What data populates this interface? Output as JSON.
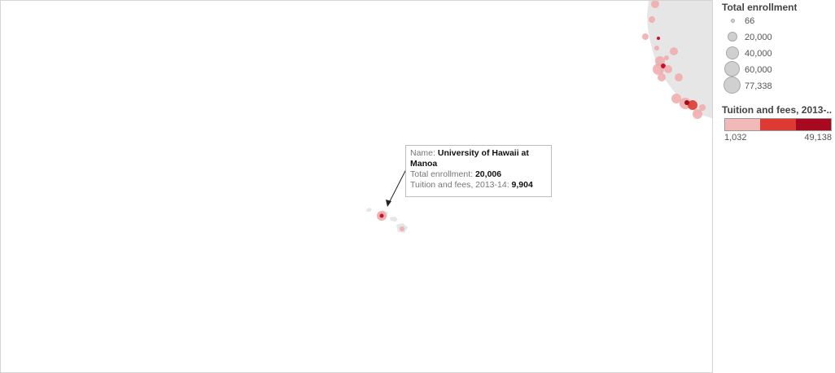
{
  "legend": {
    "size_title": "Total  enrollment",
    "size_items": [
      "66",
      "20,000",
      "40,000",
      "60,000",
      "77,338"
    ],
    "color_title": "Tuition and fees, 2013-..",
    "color_min": "1,032",
    "color_max": "49,138",
    "color_steps": [
      "#f2b9b9",
      "#dc3a32",
      "#a7091f"
    ]
  },
  "tooltip": {
    "name_label": "Name:",
    "name_value": "University of Hawaii at Manoa",
    "enrollment_label": "Total  enrollment:",
    "enrollment_value": "20,006",
    "tuition_label": "Tuition and fees, 2013-14:",
    "tuition_value": "9,904"
  },
  "colors": {
    "land": "#e6e6e6",
    "marker_light": "#f0a9a9",
    "marker_dark": "#c8102e"
  }
}
